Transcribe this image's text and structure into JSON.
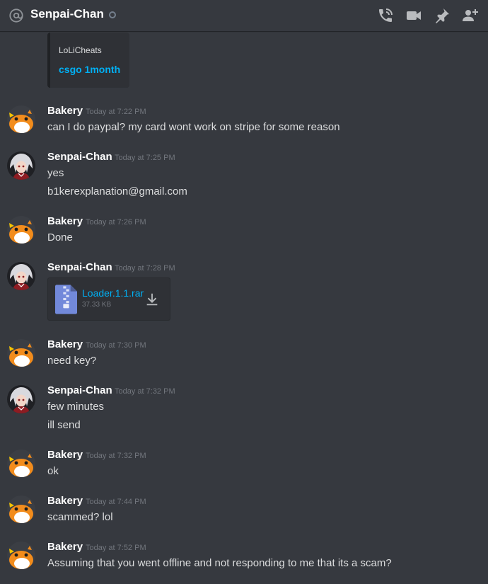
{
  "header": {
    "channel_name": "Senpai-Chan",
    "icons": [
      "at-icon",
      "status-offline-icon",
      "call-icon",
      "video-icon",
      "pin-icon",
      "add-friend-icon"
    ]
  },
  "embed": {
    "provider": "LoLiCheats",
    "title": "csgo 1month"
  },
  "messages": [
    {
      "author": "Bakery",
      "time": "Today at 7:22 PM",
      "lines": [
        "can I do paypal? my card wont work on stripe for some reason"
      ]
    },
    {
      "author": "Senpai-Chan",
      "time": "Today at 7:25 PM",
      "lines": [
        "yes",
        "b1kerexplanation@gmail.com"
      ]
    },
    {
      "author": "Bakery",
      "time": "Today at 7:26 PM",
      "lines": [
        "Done"
      ]
    },
    {
      "author": "Senpai-Chan",
      "time": "Today at 7:28 PM",
      "lines": []
    },
    {
      "author": "Bakery",
      "time": "Today at 7:30 PM",
      "lines": [
        "need key?"
      ]
    },
    {
      "author": "Senpai-Chan",
      "time": "Today at 7:32 PM",
      "lines": [
        "few minutes",
        "ill send"
      ]
    },
    {
      "author": "Bakery",
      "time": "Today at 7:32 PM",
      "lines": [
        "ok"
      ]
    },
    {
      "author": "Bakery",
      "time": "Today at 7:44 PM",
      "lines": [
        "scammed? lol"
      ]
    },
    {
      "author": "Bakery",
      "time": "Today at 7:52 PM",
      "lines": [
        "Assuming that you went offline and not responding to me that its a scam?"
      ]
    }
  ],
  "attachment": {
    "file_name": "Loader.1.1.rar",
    "file_size": "37.33 KB",
    "icon": "archive-file-icon"
  },
  "colors": {
    "background": "#36393f",
    "link": "#00b0f4",
    "timestamp": "#72767d",
    "text": "#dcddde"
  }
}
